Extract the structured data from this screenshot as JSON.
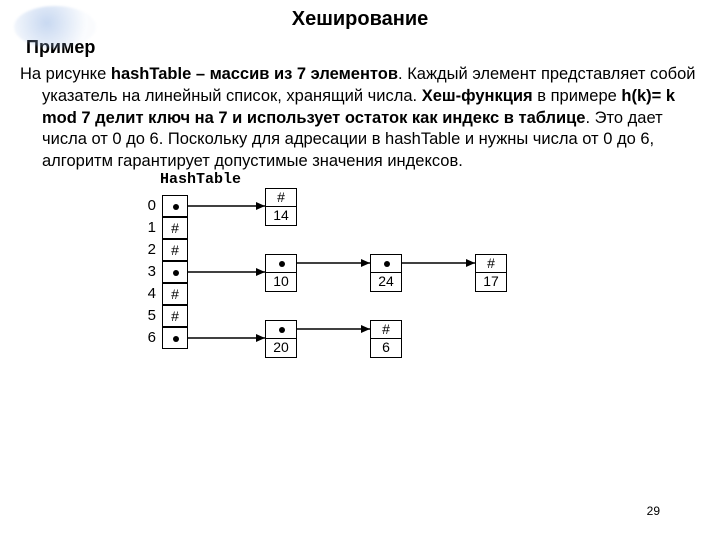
{
  "title": "Хеширование",
  "subtitle": "Пример",
  "paragraph_html": "На рисунке <b>hashTable – массив из 7 элементов</b>. Каждый элемент представляет собой указатель на линейный список, хранящий числа. <b>Хеш-функция</b> в примере <b>h(k)= k mod 7 делит ключ на 7 и использует остаток как индекс в таблице</b>. Это дает числа от 0 до 6. Поскольку для адресации в hashTable и нужны числа от 0 до 6, алгоритм гарантирует допустимые значения индексов.",
  "diagram": {
    "label": "HashTable",
    "indices": [
      "0",
      "1",
      "2",
      "3",
      "4",
      "5",
      "6"
    ],
    "slots": [
      "ptr",
      "#",
      "#",
      "ptr",
      "#",
      "#",
      "ptr"
    ],
    "chains": {
      "0": [
        {
          "term": true,
          "val": "14"
        }
      ],
      "3": [
        {
          "term": false,
          "val": "10"
        },
        {
          "term": false,
          "val": "24"
        },
        {
          "term": true,
          "val": "17"
        }
      ],
      "6": [
        {
          "term": false,
          "val": "20"
        },
        {
          "term": true,
          "val": "6"
        }
      ]
    }
  },
  "page_number": "29"
}
